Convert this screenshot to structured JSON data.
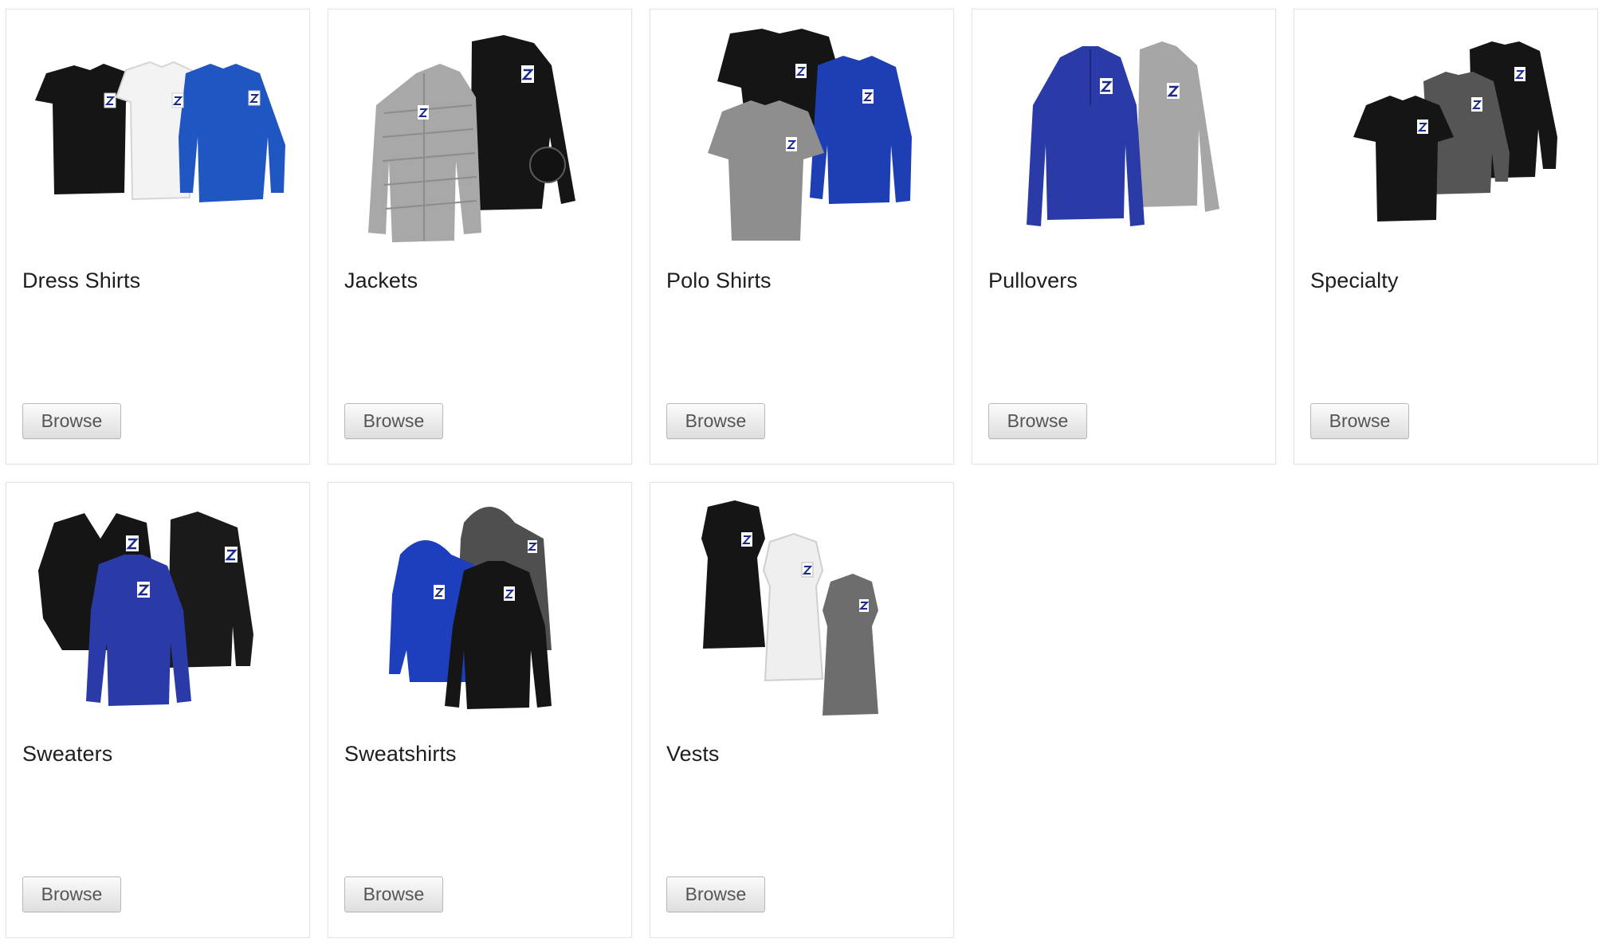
{
  "categories": [
    {
      "title": "Dress Shirts",
      "browse_label": "Browse"
    },
    {
      "title": "Jackets",
      "browse_label": "Browse"
    },
    {
      "title": "Polo Shirts",
      "browse_label": "Browse"
    },
    {
      "title": "Pullovers",
      "browse_label": "Browse"
    },
    {
      "title": "Specialty",
      "browse_label": "Browse"
    },
    {
      "title": "Sweaters",
      "browse_label": "Browse"
    },
    {
      "title": "Sweatshirts",
      "browse_label": "Browse"
    },
    {
      "title": "Vests",
      "browse_label": "Browse"
    }
  ],
  "colors": {
    "black_garment": "#151515",
    "white_garment": "#f2f2f2",
    "royal_blue": "#1f56c2",
    "dark_royal": "#2a3ba8",
    "silver_gray": "#a7a7a7",
    "charcoal": "#555555",
    "logo_badge": "#ffffff",
    "logo_mark": "#1b2b8a"
  }
}
